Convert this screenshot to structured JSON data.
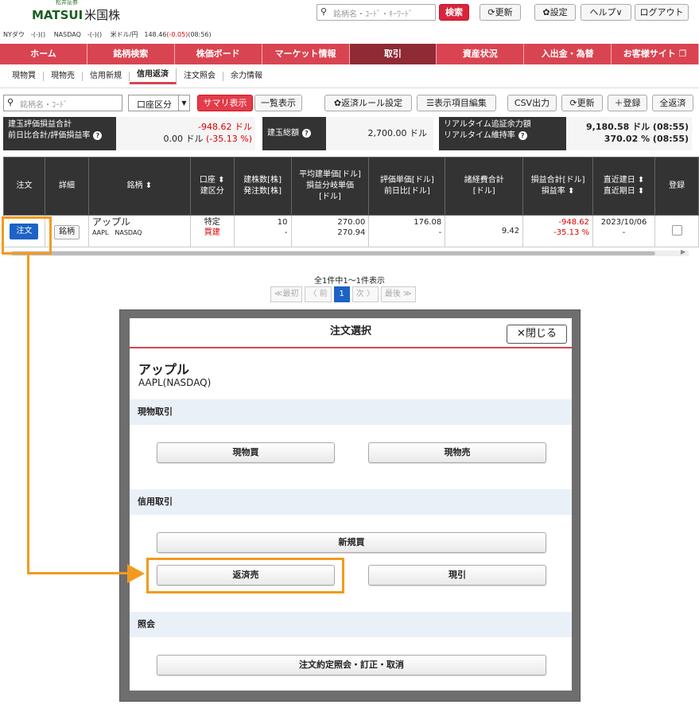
{
  "header": {
    "logo_small": "松井証券",
    "logo_main": "MATSUI",
    "logo_sub": "米国株",
    "search_placeholder": "銘柄名・ｺｰﾄﾞ・ｷｰﾜｰﾄﾞ",
    "search_btn": "検索",
    "refresh": "更新",
    "settings": "設定",
    "help": "ヘルプ",
    "logout": "ログアウト"
  },
  "ticker": {
    "nydow": "NYダウ　-(-)()",
    "nasdaq": "NASDAQ　-(-)()",
    "usdjpy_label": "米ドル/円　148.46",
    "usdjpy_change": "(-0.05)",
    "usdjpy_time": "(08:56)"
  },
  "main_nav": [
    "ホーム",
    "銘柄検索",
    "株価ボード",
    "マーケット情報",
    "取引",
    "資産状況",
    "入出金・為替",
    "お客様サイト"
  ],
  "sub_nav": [
    "現物買",
    "現物売",
    "信用新規",
    "信用返済",
    "注文照会",
    "余力情報"
  ],
  "toolbar": {
    "code_placeholder": "銘柄名・ｺｰﾄﾞ",
    "account": "口座区分",
    "summary_tab": "サマリ表示",
    "list_tab": "一覧表示",
    "settle_rule": "返済ルール設定",
    "col_edit": "表示項目編集",
    "csv": "CSV出力",
    "refresh": "更新",
    "register": "登録",
    "settle_all": "全返済"
  },
  "summary": {
    "label1a": "建玉評価損益合計",
    "label1b": "前日比合計/評価損益率",
    "value1a": "-948.62 ドル",
    "value1b": "0.00 ドル",
    "value1c": "(-35.13 %)",
    "label2": "建玉総額",
    "value2": "2,700.00 ドル",
    "label3a": "リアルタイム追証余力額",
    "label3b": "リアルタイム維持率",
    "value3a": "9,180.58 ドル (08:55)",
    "value3b": "370.02 % (08:55)"
  },
  "table": {
    "headers": [
      "注文",
      "詳細",
      "銘柄 ⬍",
      "口座 ⬍\n建区分",
      "建株数[株]\n発注数[株]",
      "平均建単価[ドル]\n損益分岐単価\n[ドル]",
      "評価単価[ドル]\n前日比[ドル]",
      "諸経費合計\n[ドル]",
      "損益合計[ドル]\n損益率 ⬍",
      "直近建日 ⬍\n直近期日 ⬍",
      "登録"
    ],
    "row": {
      "order_btn": "注文",
      "detail_btn": "銘柄",
      "name": "アップル",
      "code": "AAPL　NASDAQ",
      "account": "特定",
      "type": "買建",
      "qty": "10",
      "ordered": "-",
      "avg_price": "270.00",
      "breakeven": "270.94",
      "eval_price": "176.08",
      "change": "-",
      "fees": "9.42",
      "pl": "-948.62",
      "pl_rate": "-35.13 %",
      "date": "2023/10/06",
      "due": "-"
    }
  },
  "pagination": {
    "info": "全1件中1～1件表示",
    "first": "≪最初",
    "prev": "〈 前",
    "current": "1",
    "next": "次 〉",
    "last": "最後 ≫"
  },
  "modal": {
    "title": "注文選択",
    "close": "閉じる",
    "stock_name": "アップル",
    "stock_code": "AAPL(NASDAQ)",
    "sec_cash": "現物取引",
    "cash_buy": "現物買",
    "cash_sell": "現物売",
    "sec_margin": "信用取引",
    "new_buy": "新規買",
    "settle_sell": "返済売",
    "genbiki": "現引",
    "sec_inquiry": "照会",
    "order_inquiry": "注文約定照会・訂正・取消"
  },
  "colors": {
    "brand_red": "#d94452",
    "highlight": "#f39a1e",
    "order_blue": "#1d62c6"
  }
}
